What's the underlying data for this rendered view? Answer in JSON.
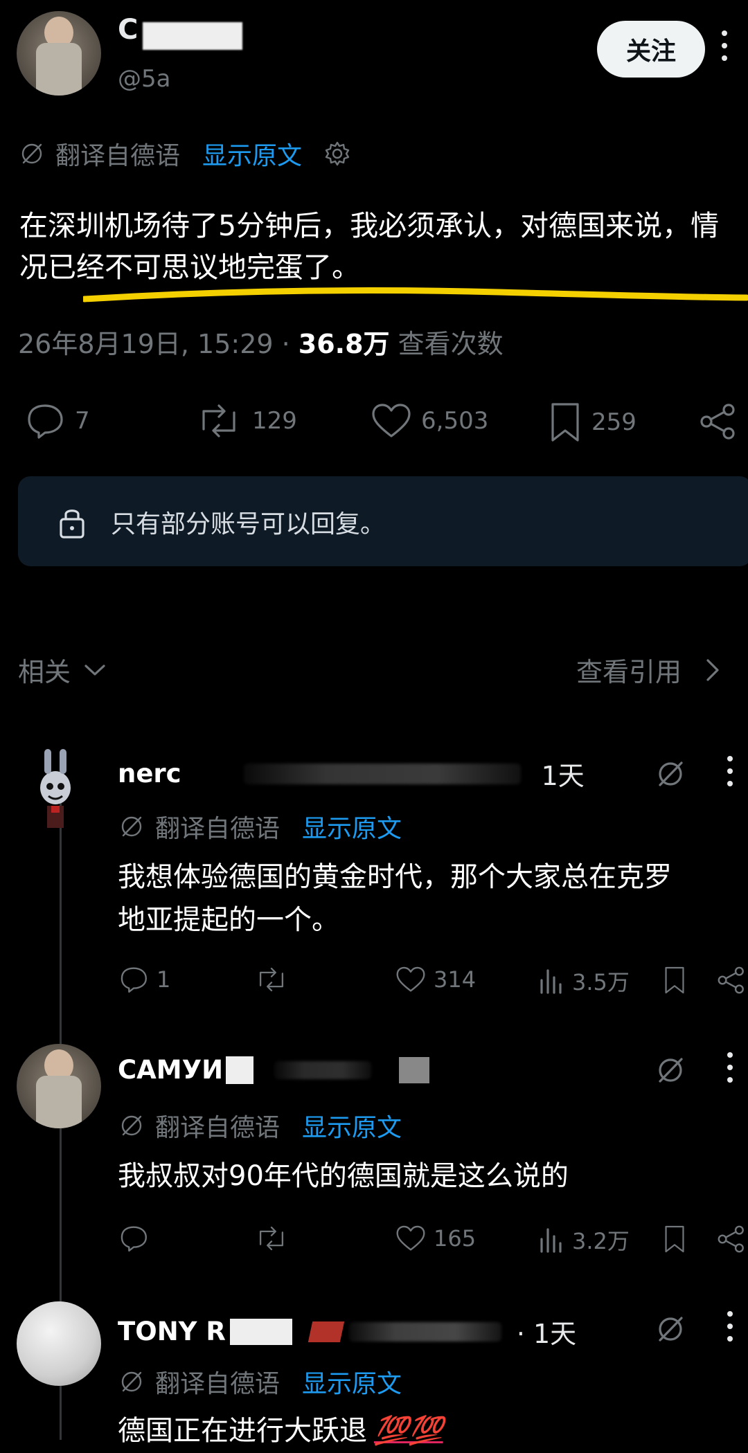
{
  "post": {
    "author_name_visible": "C",
    "handle_visible": "@5a",
    "follow_label": "关注",
    "translated_label": "翻译自德语",
    "show_original": "显示原文",
    "text": "在深圳机场待了5分钟后，我必须承认，对德国来说，情况已经不可思议地完蛋了。",
    "timestamp": "26年8月19日, 15:29 · ",
    "views": "36.8万",
    "views_label": " 查看次数",
    "stats": {
      "replies": "7",
      "reposts": "129",
      "likes": "6,503",
      "bookmarks": "259"
    },
    "reply_restriction": "只有部分账号可以回复。"
  },
  "related": {
    "label": "相关",
    "quotes_label": "查看引用"
  },
  "comments": [
    {
      "name_visible": "nerc",
      "time": "1天",
      "translated_label": "翻译自德语",
      "show_original": "显示原文",
      "text_line1": "我想体验德国的黄金时代，那个大家总在克罗",
      "text_line2": "地亚提起的一个。",
      "replies": "1",
      "likes": "314",
      "views": "3.5万"
    },
    {
      "name_visible": "САМУИ",
      "time": "",
      "translated_label": "翻译自德语",
      "show_original": "显示原文",
      "text_line1": "我叔叔对90年代的德国就是这么说的",
      "likes": "165",
      "views": "3.2万"
    },
    {
      "name_visible": "TONY R",
      "time": "· 1天",
      "translated_label": "翻译自德语",
      "show_original": "显示原文",
      "text_line1": "德国正在进行大跃退",
      "emoji": "💯💯"
    }
  ],
  "colors": {
    "accent": "#1d9bf0",
    "muted": "#71767b",
    "highlight": "#f5d000"
  }
}
